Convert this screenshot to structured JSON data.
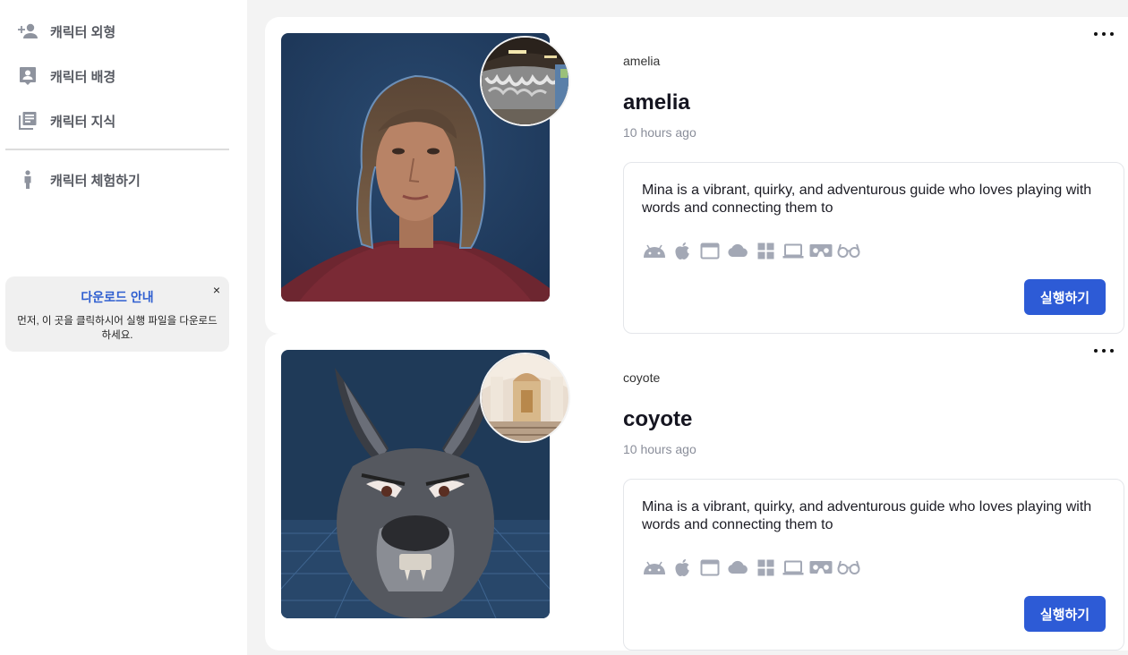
{
  "sidebar": {
    "items": [
      {
        "label": "캐릭터 외형",
        "icon": "person-add-icon"
      },
      {
        "label": "캐릭터 배경",
        "icon": "contact-card-icon"
      },
      {
        "label": "캐릭터 지식",
        "icon": "library-books-icon"
      },
      {
        "label": "캐릭터 체험하기",
        "icon": "standing-person-icon"
      }
    ],
    "notice": {
      "title": "다운로드 안내",
      "body": "먼저, 이 곳을 클릭하시어 실행 파일을 다운로드 하세요.",
      "close_label": "×"
    }
  },
  "characters": [
    {
      "small_name": "amelia",
      "name": "amelia",
      "time": "10 hours ago",
      "description": "Mina is a vibrant, quirky, and adventurous guide who loves playing with words and connecting them to",
      "run_label": "실행하기",
      "portrait": "female-avatar-portrait",
      "background": "graffiti-tunnel-thumbnail"
    },
    {
      "small_name": "coyote",
      "name": "coyote",
      "time": "10 hours ago",
      "description": "Mina is a vibrant, quirky, and adventurous guide who loves playing with words and connecting them to",
      "run_label": "실행하기",
      "portrait": "coyote-avatar-portrait",
      "background": "cathedral-interior-thumbnail"
    }
  ],
  "platform_icons": [
    "android-icon",
    "apple-icon",
    "browser-window-icon",
    "cloud-icon",
    "windows-icon",
    "laptop-icon",
    "vr-headset-icon",
    "ar-glasses-icon"
  ],
  "colors": {
    "accent": "#2d5bd6",
    "notice_title": "#2f5fd0",
    "platform_icon": "#a3a8b5",
    "time_text": "#8a8e9a"
  }
}
